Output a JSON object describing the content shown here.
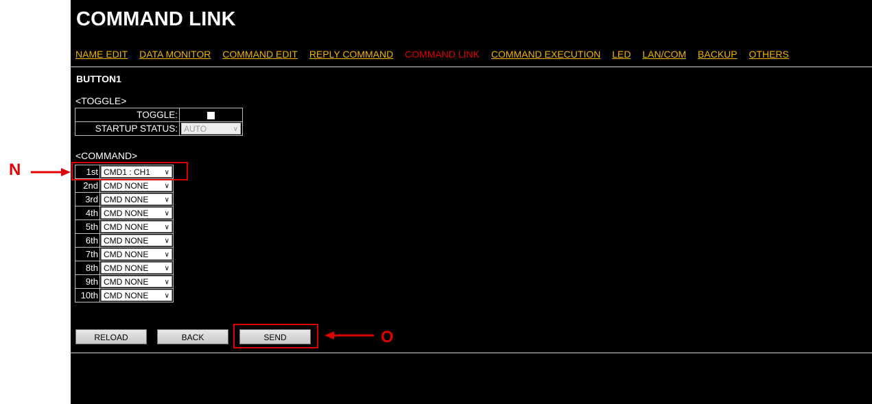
{
  "page_title": "COMMAND LINK",
  "nav": [
    {
      "label": "NAME EDIT",
      "active": false
    },
    {
      "label": "DATA MONITOR",
      "active": false
    },
    {
      "label": "COMMAND EDIT",
      "active": false
    },
    {
      "label": "REPLY COMMAND",
      "active": false
    },
    {
      "label": "COMMAND LINK",
      "active": true
    },
    {
      "label": "COMMAND EXECUTION",
      "active": false
    },
    {
      "label": "LED",
      "active": false
    },
    {
      "label": "LAN/COM",
      "active": false
    },
    {
      "label": "BACKUP",
      "active": false
    },
    {
      "label": "OTHERS",
      "active": false
    }
  ],
  "button_name": "BUTTON1",
  "toggle_section": {
    "heading": "<TOGGLE>",
    "toggle_label": "TOGGLE:",
    "toggle_checked": false,
    "startup_label": "STARTUP STATUS:",
    "startup_value": "AUTO",
    "startup_disabled": true
  },
  "command_section": {
    "heading": "<COMMAND>",
    "rows": [
      {
        "order": "1st",
        "value": "CMD1 : CH1"
      },
      {
        "order": "2nd",
        "value": "CMD NONE"
      },
      {
        "order": "3rd",
        "value": "CMD NONE"
      },
      {
        "order": "4th",
        "value": "CMD NONE"
      },
      {
        "order": "5th",
        "value": "CMD NONE"
      },
      {
        "order": "6th",
        "value": "CMD NONE"
      },
      {
        "order": "7th",
        "value": "CMD NONE"
      },
      {
        "order": "8th",
        "value": "CMD NONE"
      },
      {
        "order": "9th",
        "value": "CMD NONE"
      },
      {
        "order": "10th",
        "value": "CMD NONE"
      }
    ]
  },
  "buttons": {
    "reload": "RELOAD",
    "back": "BACK",
    "send": "SEND"
  },
  "annotations": {
    "n": "N",
    "o": "O",
    "color": "#e00000"
  },
  "colors": {
    "background": "#000000",
    "nav_link": "#f0b400",
    "nav_active": "#e00000"
  }
}
